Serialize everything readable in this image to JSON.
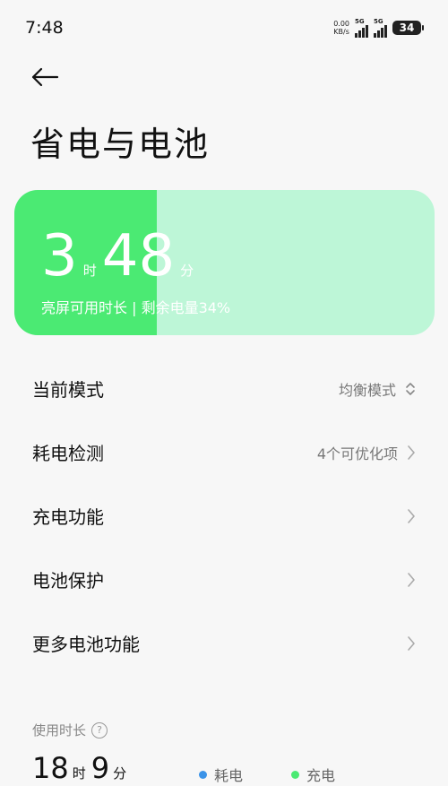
{
  "status_bar": {
    "time": "7:48",
    "net_speed_value": "0.00",
    "net_speed_unit": "KB/s",
    "sim1": "5G",
    "sim2": "5G",
    "battery": "34"
  },
  "header": {
    "title": "省电与电池"
  },
  "battery_card": {
    "hours": "3",
    "hours_unit": "时",
    "minutes": "48",
    "minutes_unit": "分",
    "subtitle": "亮屏可用时长 | 剩余电量34%",
    "level_percent": 34,
    "fill_color": "#4bea73",
    "track_color": "#bdf6d7"
  },
  "settings": [
    {
      "label": "当前模式",
      "value": "均衡模式",
      "icon": "updown-chevron-icon"
    },
    {
      "label": "耗电检测",
      "value": "4个可优化项",
      "icon": "chevron-right-icon"
    },
    {
      "label": "充电功能",
      "value": "",
      "icon": "chevron-right-icon"
    },
    {
      "label": "电池保护",
      "value": "",
      "icon": "chevron-right-icon"
    },
    {
      "label": "更多电池功能",
      "value": "",
      "icon": "chevron-right-icon"
    }
  ],
  "usage": {
    "label": "使用时长",
    "hours": "18",
    "hours_unit": "时",
    "minutes": "9",
    "minutes_unit": "分",
    "legend": [
      {
        "label": "耗电",
        "color": "#3b93e8"
      },
      {
        "label": "充电",
        "color": "#4bea73"
      }
    ]
  }
}
